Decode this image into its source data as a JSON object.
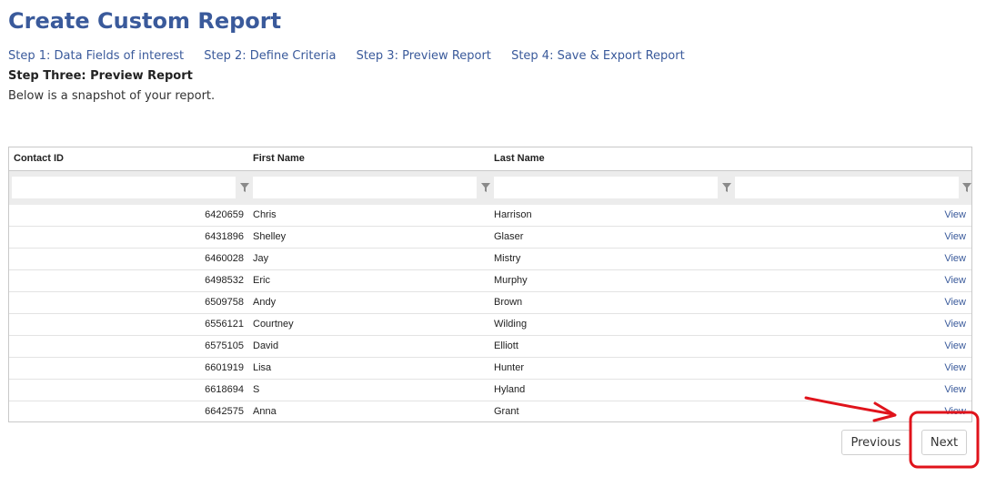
{
  "page": {
    "title": "Create Custom Report"
  },
  "steps": [
    {
      "label": "Step 1: Data Fields of interest"
    },
    {
      "label": "Step 2: Define Criteria"
    },
    {
      "label": "Step 3: Preview Report"
    },
    {
      "label": "Step 4: Save & Export Report"
    }
  ],
  "section": {
    "heading": "Step Three: Preview Report",
    "description": "Below is a snapshot of your report."
  },
  "table": {
    "columns": [
      "Contact ID",
      "First Name",
      "Last Name",
      ""
    ],
    "filters": [
      "",
      "",
      "",
      ""
    ],
    "filter_icon": "funnel-filter-icon",
    "rows": [
      {
        "id": "6420659",
        "first": "Chris",
        "last": "Harrison",
        "action": "View"
      },
      {
        "id": "6431896",
        "first": "Shelley",
        "last": "Glaser",
        "action": "View"
      },
      {
        "id": "6460028",
        "first": "Jay",
        "last": "Mistry",
        "action": "View"
      },
      {
        "id": "6498532",
        "first": "Eric",
        "last": "Murphy",
        "action": "View"
      },
      {
        "id": "6509758",
        "first": "Andy",
        "last": "Brown",
        "action": "View"
      },
      {
        "id": "6556121",
        "first": "Courtney",
        "last": "Wilding",
        "action": "View"
      },
      {
        "id": "6575105",
        "first": "David",
        "last": "Elliott",
        "action": "View"
      },
      {
        "id": "6601919",
        "first": "Lisa",
        "last": "Hunter",
        "action": "View"
      },
      {
        "id": "6618694",
        "first": "S",
        "last": "Hyland",
        "action": "View"
      },
      {
        "id": "6642575",
        "first": "Anna",
        "last": "Grant",
        "action": "View"
      }
    ]
  },
  "pager": {
    "previous_label": "Previous",
    "next_label": "Next"
  },
  "colors": {
    "accent": "#3a5a9b",
    "annotation": "#e0131b"
  }
}
